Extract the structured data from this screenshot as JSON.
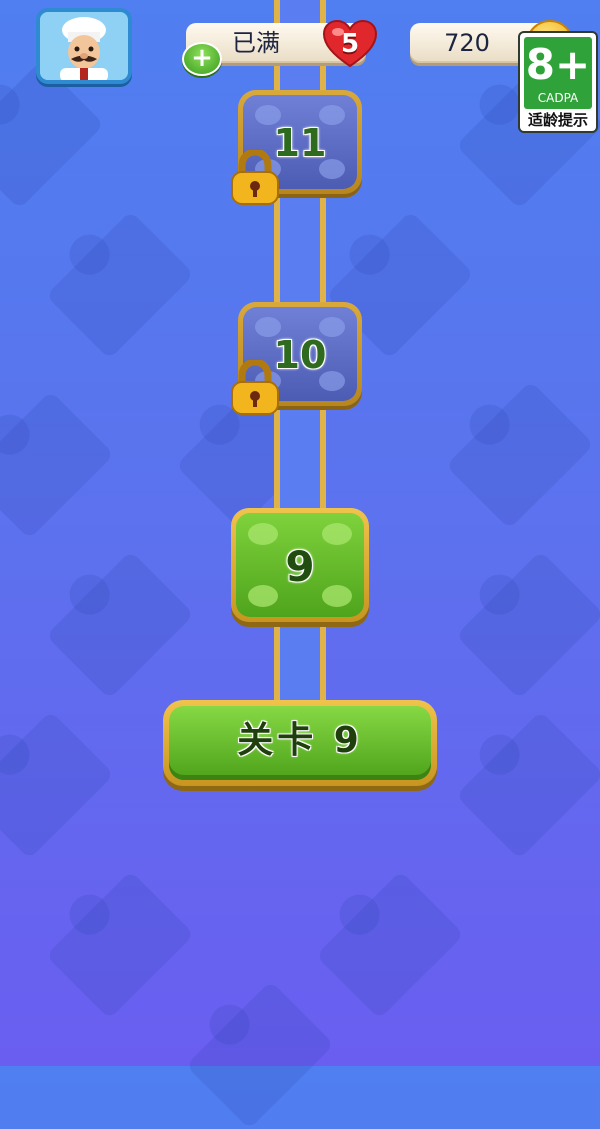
{
  "hud": {
    "lives_status": "已满",
    "lives_count": "5",
    "coins": "720"
  },
  "age_rating": {
    "rating": "8+",
    "org": "CADPA",
    "label": "适龄提示"
  },
  "levels": [
    {
      "number": "11",
      "state": "locked"
    },
    {
      "number": "10",
      "state": "locked"
    },
    {
      "number": "9",
      "state": "current"
    }
  ],
  "play_button": {
    "label": "关卡 9"
  },
  "icons": {
    "avatar": "chef-avatar-icon",
    "plus": "plus-icon",
    "heart": "heart-icon",
    "coin": "coin-icon",
    "lock": "padlock-icon"
  },
  "colors": {
    "background_top": "#4f7ff0",
    "background_bottom": "#6a5ef0",
    "locked_tile": "#5a68c2",
    "current_tile": "#66bd2e",
    "gold_border": "#e0b24a"
  }
}
